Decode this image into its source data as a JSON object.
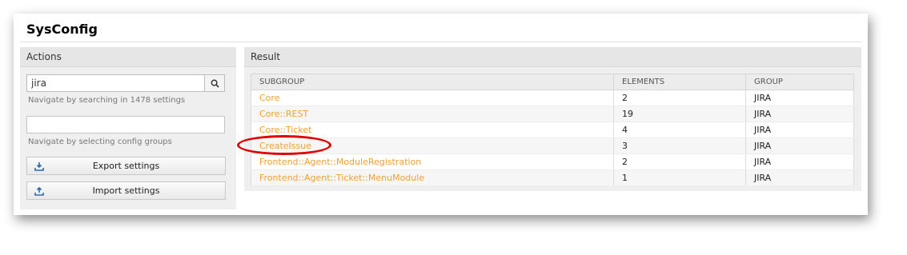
{
  "page": {
    "title": "SysConfig"
  },
  "actions": {
    "header": "Actions",
    "search": {
      "value": "jira",
      "placeholder": ""
    },
    "search_hint": "Navigate by searching in 1478 settings",
    "group_hint": "Navigate by selecting config groups",
    "export_label": "Export settings",
    "import_label": "Import settings"
  },
  "result": {
    "header": "Result",
    "columns": [
      "SUBGROUP",
      "ELEMENTS",
      "GROUP"
    ],
    "rows": [
      {
        "subgroup": "Core",
        "elements": "2",
        "group": "JIRA"
      },
      {
        "subgroup": "Core::REST",
        "elements": "19",
        "group": "JIRA"
      },
      {
        "subgroup": "Core::Ticket",
        "elements": "4",
        "group": "JIRA"
      },
      {
        "subgroup": "CreateIssue",
        "elements": "3",
        "group": "JIRA"
      },
      {
        "subgroup": "Frontend::Agent::ModuleRegistration",
        "elements": "2",
        "group": "JIRA"
      },
      {
        "subgroup": "Frontend::Agent::Ticket::MenuModule",
        "elements": "1",
        "group": "JIRA"
      }
    ]
  },
  "colors": {
    "link": "#f0a030",
    "highlight": "#e00000"
  }
}
